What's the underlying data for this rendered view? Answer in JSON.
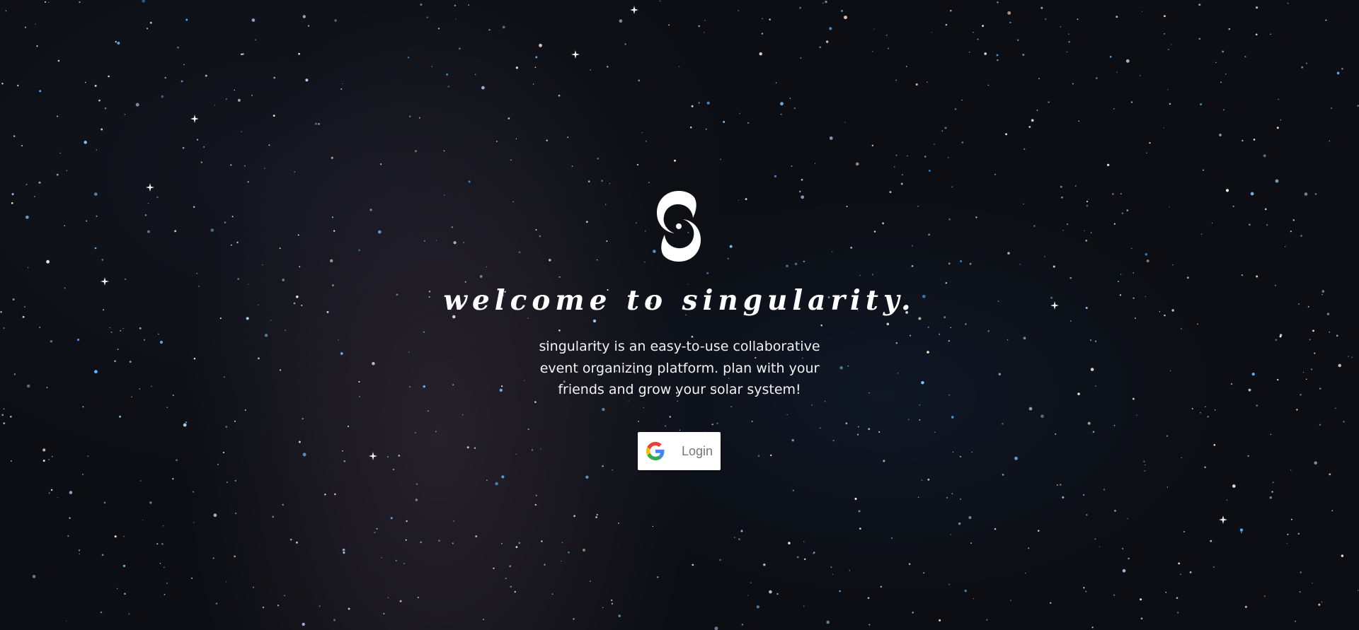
{
  "hero": {
    "title": "welcome to singularity.",
    "description": "singularity is an easy-to-use collaborative event organizing platform. plan with your friends and grow your solar system!"
  },
  "login": {
    "label": "Login",
    "icon": "google-icon"
  },
  "logo": {
    "icon": "singularity-logo",
    "color": "#ffffff"
  },
  "background": {
    "type": "starfield",
    "color": "#0c0e13"
  }
}
